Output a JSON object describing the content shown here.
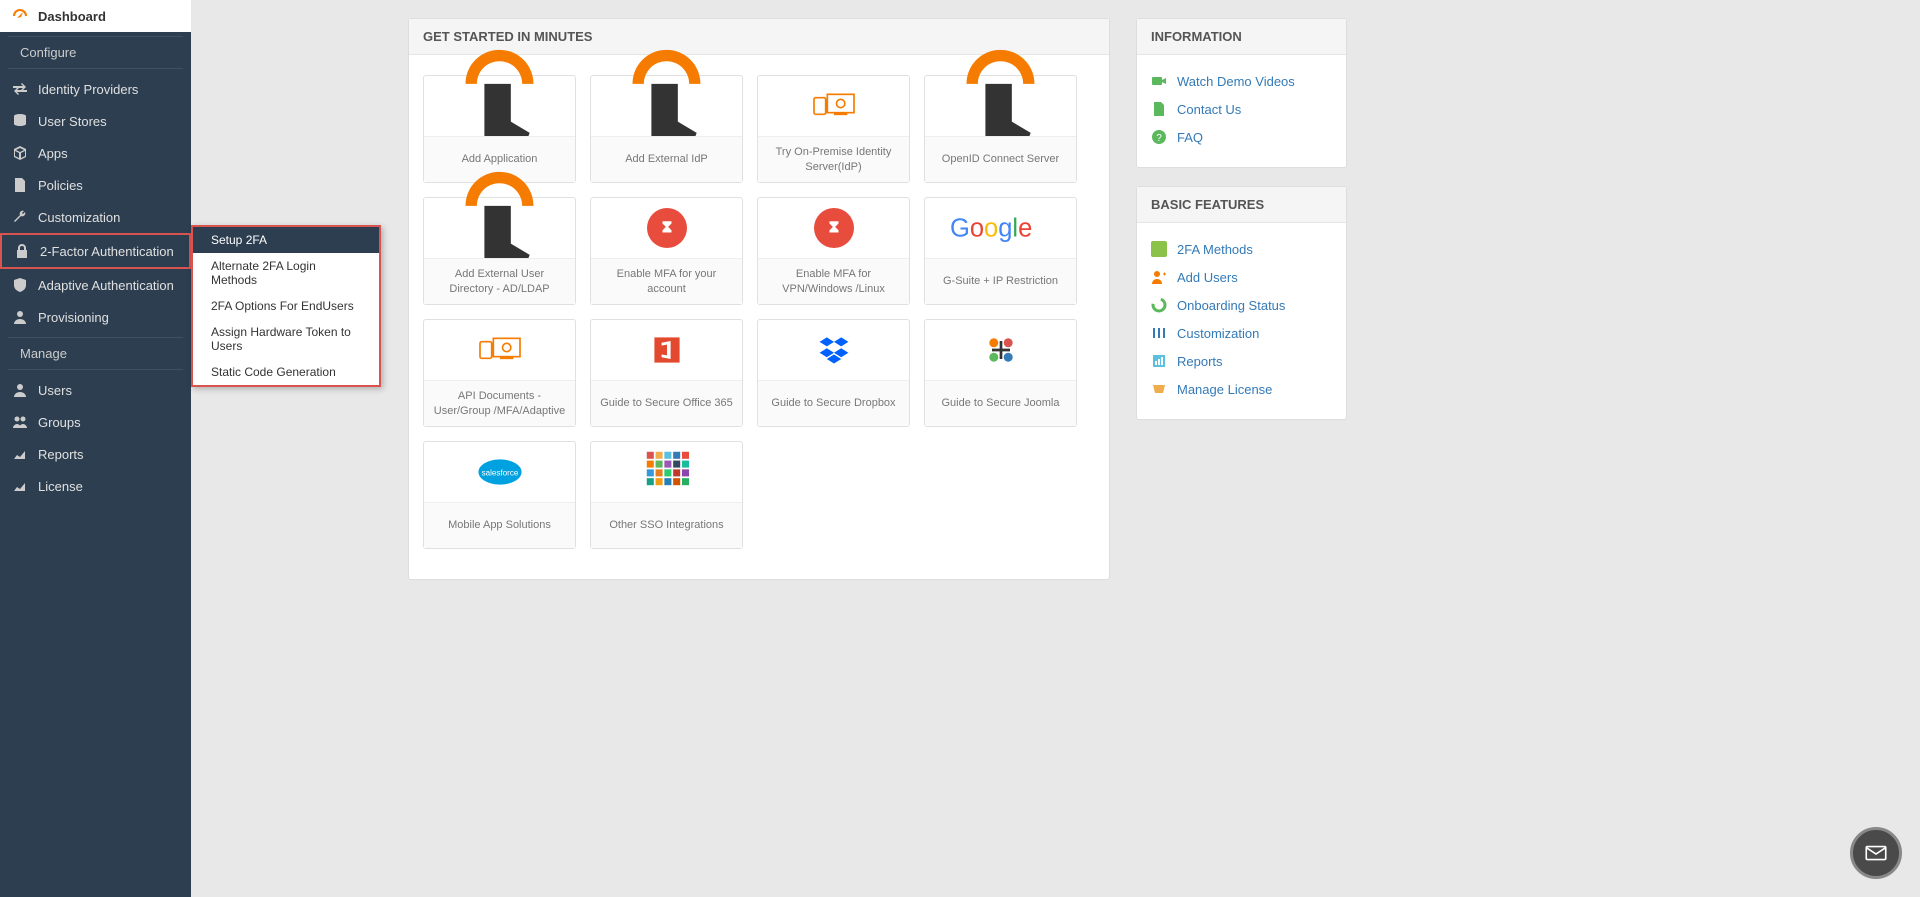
{
  "sidebar": {
    "items": [
      {
        "label": "Dashboard"
      },
      {
        "label": "Identity Providers"
      },
      {
        "label": "User Stores"
      },
      {
        "label": "Apps"
      },
      {
        "label": "Policies"
      },
      {
        "label": "Customization"
      },
      {
        "label": "2-Factor Authentication"
      },
      {
        "label": "Adaptive Authentication"
      },
      {
        "label": "Provisioning"
      },
      {
        "label": "Users"
      },
      {
        "label": "Groups"
      },
      {
        "label": "Reports"
      },
      {
        "label": "License"
      }
    ],
    "configure_label": "Configure",
    "manage_label": "Manage"
  },
  "submenu": {
    "items": [
      {
        "label": "Setup 2FA"
      },
      {
        "label": "Alternate 2FA Login Methods"
      },
      {
        "label": "2FA Options For EndUsers"
      },
      {
        "label": "Assign Hardware Token to Users"
      },
      {
        "label": "Static Code Generation"
      }
    ]
  },
  "main": {
    "header": "GET STARTED IN MINUTES",
    "cards": [
      {
        "label": "Add Application"
      },
      {
        "label": "Add External IdP"
      },
      {
        "label": "Try On-Premise Identity Server(IdP)"
      },
      {
        "label": "OpenID Connect Server"
      },
      {
        "label": "Add External User Directory - AD/LDAP"
      },
      {
        "label": "Enable MFA for your account"
      },
      {
        "label": "Enable MFA for VPN/Windows /Linux"
      },
      {
        "label": "G-Suite + IP Restriction"
      },
      {
        "label": "API Documents - User/Group /MFA/Adaptive"
      },
      {
        "label": "Guide to Secure Office 365"
      },
      {
        "label": "Guide to Secure Dropbox"
      },
      {
        "label": "Guide to Secure Joomla"
      },
      {
        "label": "Mobile App Solutions"
      },
      {
        "label": "Other SSO Integrations"
      }
    ]
  },
  "info_panel": {
    "header": "INFORMATION",
    "links": [
      {
        "label": "Watch Demo Videos",
        "icon_color": "#5cb85c"
      },
      {
        "label": "Contact Us",
        "icon_color": "#5cb85c"
      },
      {
        "label": "FAQ",
        "icon_color": "#5cb85c"
      }
    ]
  },
  "features_panel": {
    "header": "BASIC FEATURES",
    "links": [
      {
        "label": "2FA Methods"
      },
      {
        "label": "Add Users"
      },
      {
        "label": "Onboarding Status"
      },
      {
        "label": "Customization"
      },
      {
        "label": "Reports"
      },
      {
        "label": "Manage License"
      }
    ]
  }
}
